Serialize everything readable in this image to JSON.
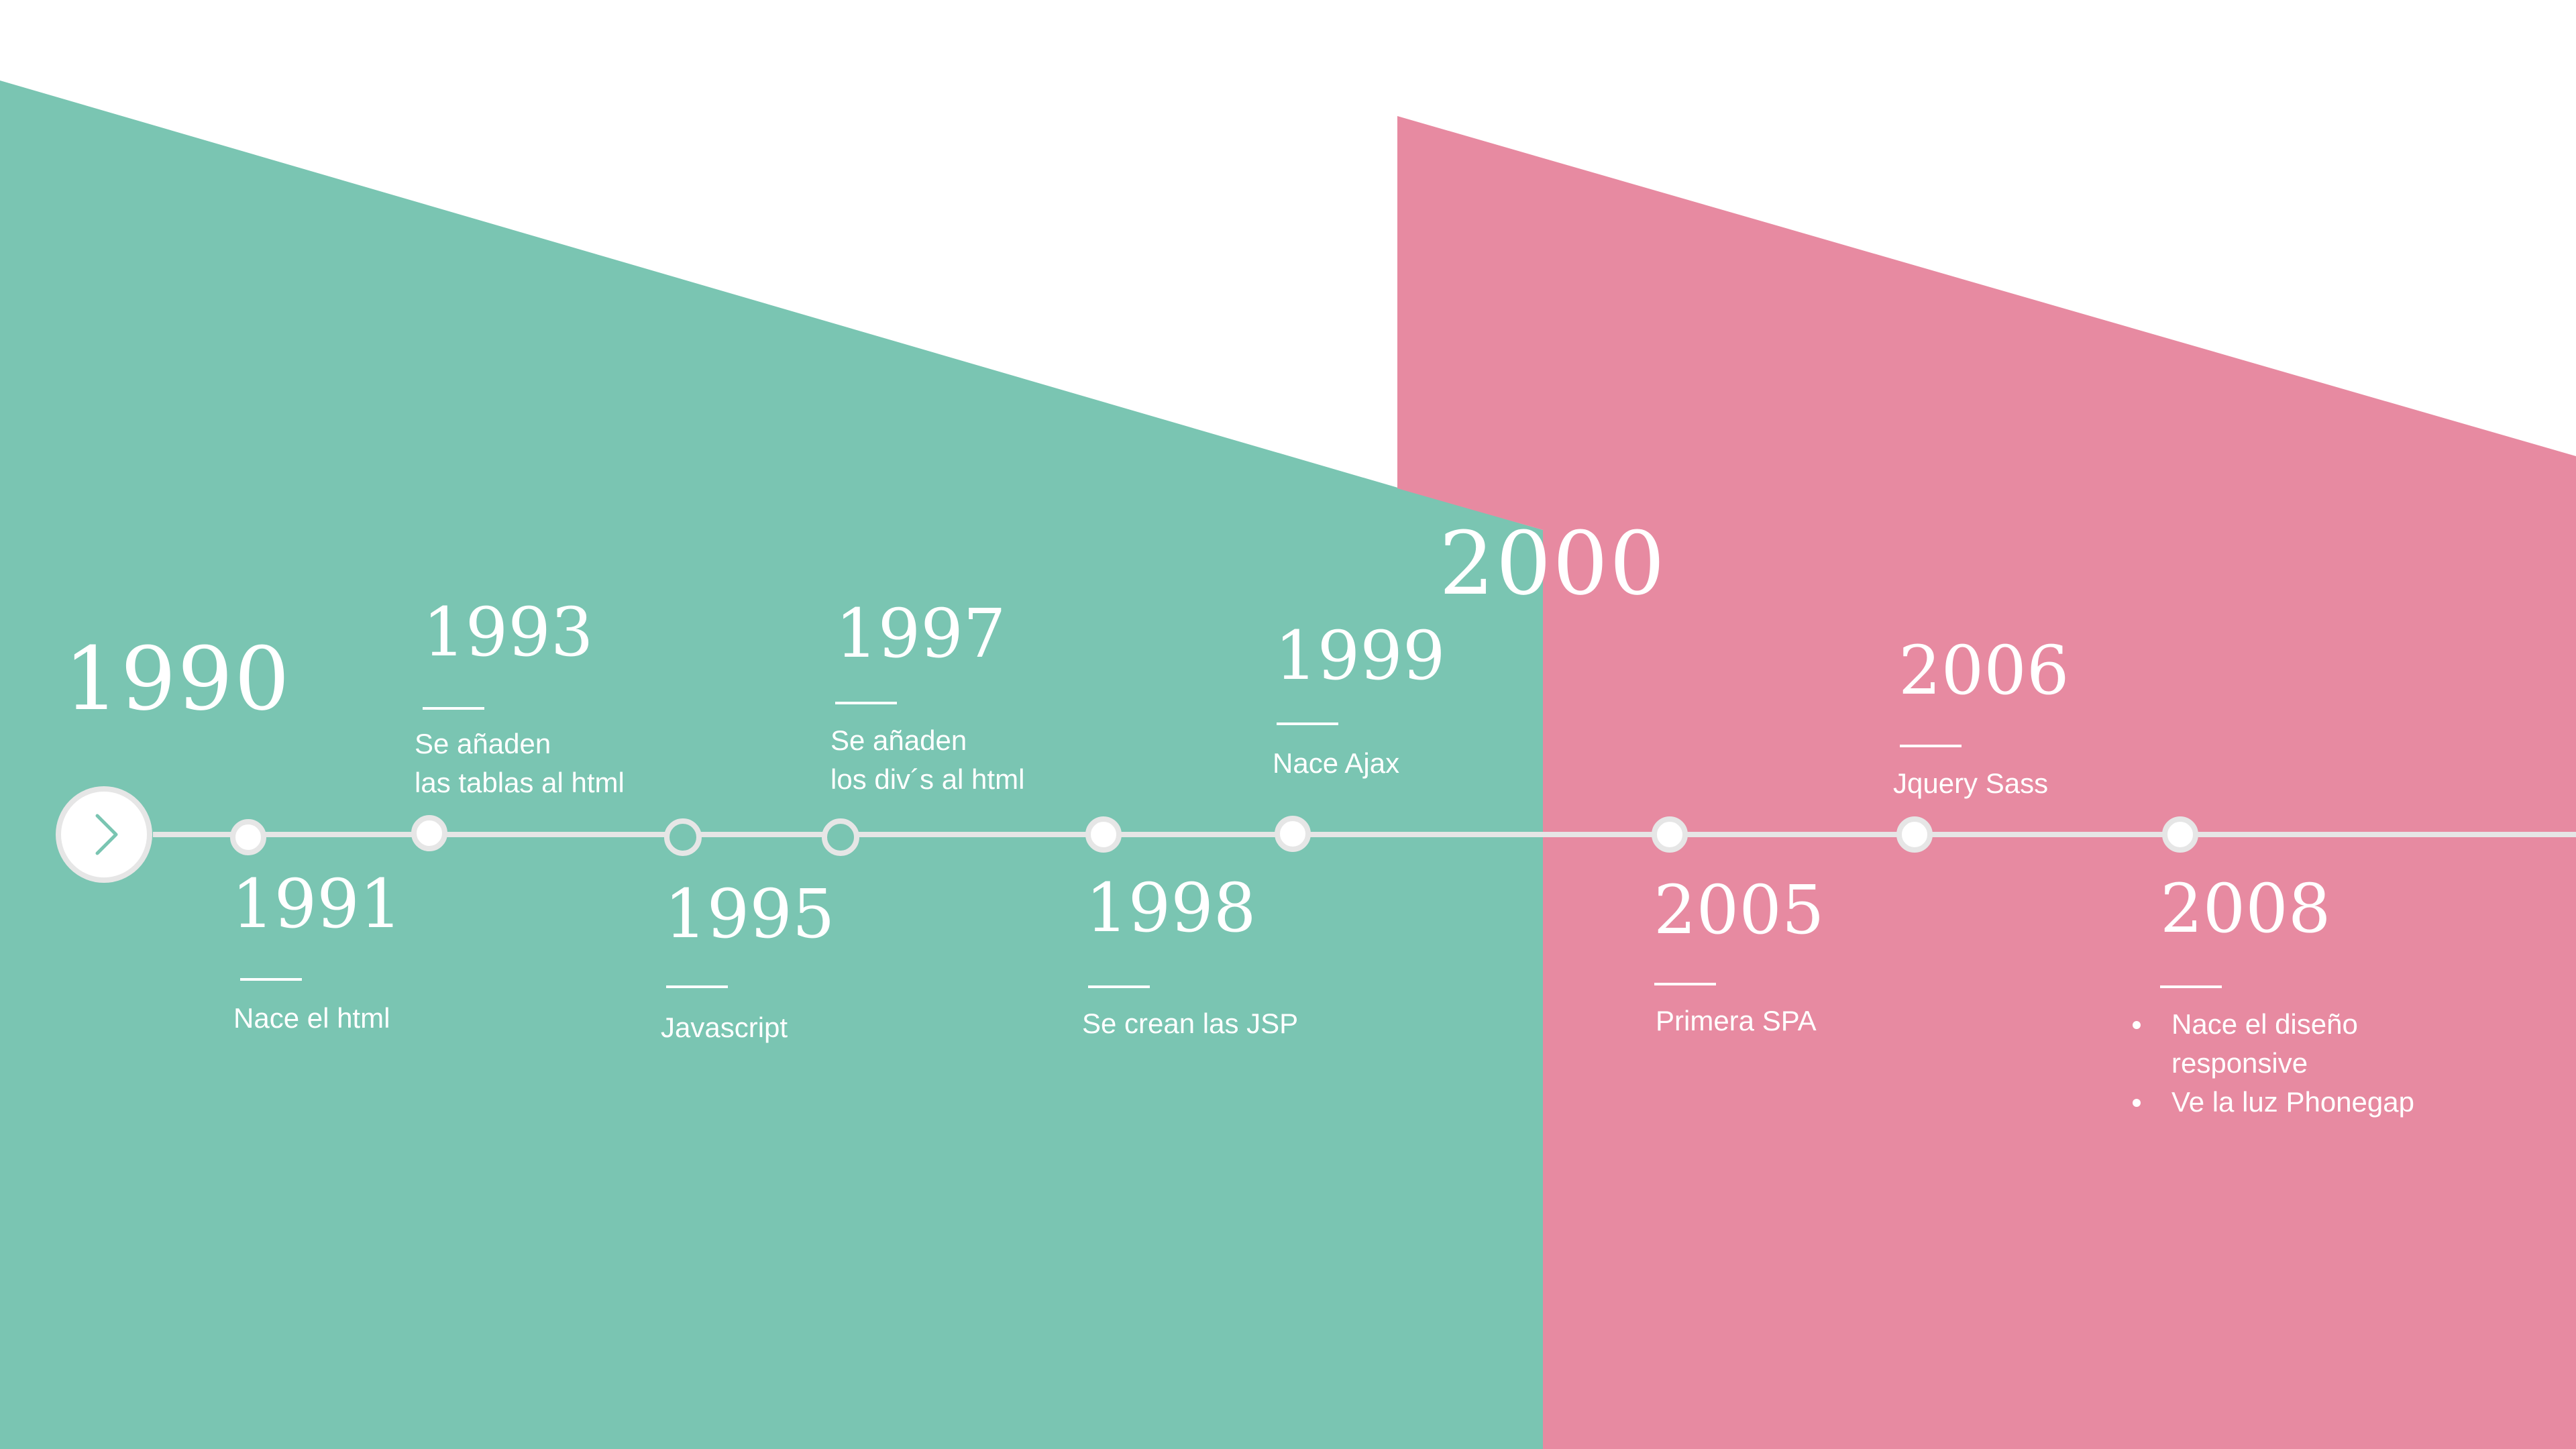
{
  "colors": {
    "teal": "#7AC5B2",
    "pink": "#E78AA1",
    "timeline": "#E6E6E6",
    "text": "#FFFFFF"
  },
  "start_button": {
    "icon": "chevron-right-icon"
  },
  "decades": [
    {
      "label": "1990"
    },
    {
      "label": "2000"
    }
  ],
  "events": [
    {
      "year": "1991",
      "lines": [
        "Nace el html"
      ]
    },
    {
      "year": "1993",
      "lines": [
        "Se añaden",
        "las tablas al html"
      ]
    },
    {
      "year": "1995",
      "lines": [
        "Javascript"
      ]
    },
    {
      "year": "1997",
      "lines": [
        "Se añaden",
        "los div´s al html"
      ]
    },
    {
      "year": "1998",
      "lines": [
        "Se crean las JSP"
      ]
    },
    {
      "year": "1999",
      "lines": [
        "Nace Ajax"
      ]
    },
    {
      "year": "2005",
      "lines": [
        "Primera SPA"
      ]
    },
    {
      "year": "2006",
      "lines": [
        "Jquery Sass"
      ]
    },
    {
      "year": "2008",
      "bullets": [
        "Nace el diseño",
        "responsive",
        "Ve la luz Phonegap"
      ]
    }
  ]
}
